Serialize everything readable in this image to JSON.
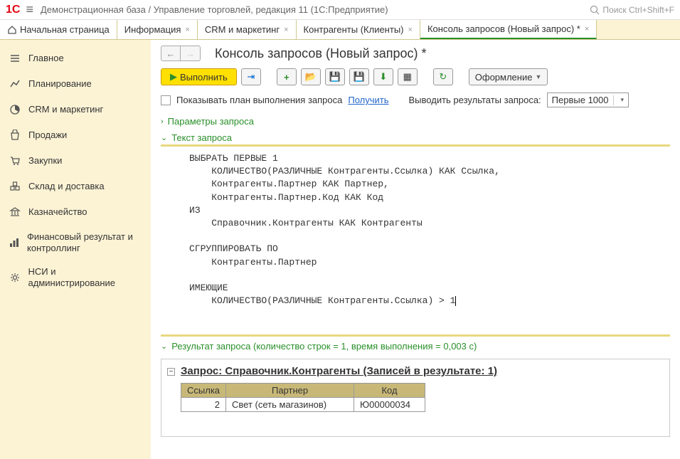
{
  "header": {
    "title": "Демонстрационная база / Управление торговлей, редакция 11 (1С:Предприятие)",
    "search_placeholder": "Поиск Ctrl+Shift+F"
  },
  "tabs": {
    "home": "Начальная страница",
    "items": [
      {
        "label": "Информация"
      },
      {
        "label": "CRM и маркетинг"
      },
      {
        "label": "Контрагенты (Клиенты)"
      },
      {
        "label": "Консоль запросов (Новый запрос) *"
      }
    ]
  },
  "sidebar": {
    "items": [
      {
        "label": "Главное"
      },
      {
        "label": "Планирование"
      },
      {
        "label": "CRM и маркетинг"
      },
      {
        "label": "Продажи"
      },
      {
        "label": "Закупки"
      },
      {
        "label": "Склад и доставка"
      },
      {
        "label": "Казначейство"
      },
      {
        "label": "Финансовый результат и контроллинг"
      },
      {
        "label": "НСИ и администрирование"
      }
    ]
  },
  "page": {
    "title": "Консоль запросов (Новый запрос) *"
  },
  "toolbar": {
    "execute": "Выполнить",
    "design": "Оформление"
  },
  "filter": {
    "show_plan": "Показывать план выполнения запроса",
    "get_link": "Получить",
    "output_label": "Выводить результаты запроса:",
    "output_value": "Первые 1000"
  },
  "sections": {
    "params": "Параметры запроса",
    "query": "Текст запроса",
    "result": "Результат запроса (количество строк = 1, время выполнения = 0,003 с)"
  },
  "query_text": "ВЫБРАТЬ ПЕРВЫЕ 1\n    КОЛИЧЕСТВО(РАЗЛИЧНЫЕ Контрагенты.Ссылка) КАК Ссылка,\n    Контрагенты.Партнер КАК Партнер,\n    Контрагенты.Партнер.Код КАК Код\nИЗ\n    Справочник.Контрагенты КАК Контрагенты\n\nСГРУППИРОВАТЬ ПО\n    Контрагенты.Партнер\n\nИМЕЮЩИЕ\n    КОЛИЧЕСТВО(РАЗЛИЧНЫЕ Контрагенты.Ссылка) > 1",
  "result": {
    "title": "Запрос: Справочник.Контрагенты (Записей в результате: 1)",
    "columns": [
      "Ссылка",
      "Партнер",
      "Код"
    ],
    "rows": [
      {
        "ssylka": "2",
        "partner": "Свет (сеть магазинов)",
        "kod": "Ю00000034"
      }
    ]
  }
}
